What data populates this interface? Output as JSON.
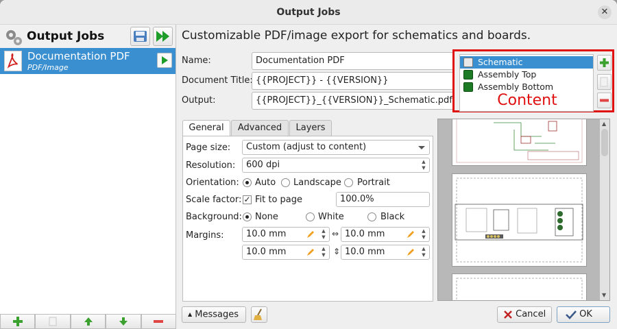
{
  "window": {
    "title": "Output Jobs"
  },
  "left_panel": {
    "title": "Output Jobs",
    "jobs": [
      {
        "name": "Documentation PDF",
        "type": "PDF/Image"
      }
    ]
  },
  "main": {
    "heading": "Customizable PDF/image export for schematics and boards.",
    "fields": {
      "name_label": "Name:",
      "name_value": "Documentation PDF",
      "doc_title_label": "Document Title:",
      "doc_title_value": "{{PROJECT}} - {{VERSION}}",
      "output_label": "Output:",
      "output_value": "{{PROJECT}}_{{VERSION}}_Schematic.pdf"
    },
    "content": {
      "items": [
        "Schematic",
        "Assembly Top",
        "Assembly Bottom"
      ],
      "selected": "Schematic",
      "caption": "Content"
    },
    "tabs": [
      "General",
      "Advanced",
      "Layers"
    ],
    "general": {
      "page_size_label": "Page size:",
      "page_size_value": "Custom (adjust to content)",
      "resolution_label": "Resolution:",
      "resolution_value": "600 dpi",
      "orientation_label": "Orientation:",
      "orientation_options": [
        "Auto",
        "Landscape",
        "Portrait"
      ],
      "orientation_selected": "Auto",
      "scale_label": "Scale factor:",
      "fit_to_page_label": "Fit to page",
      "fit_to_page_checked": true,
      "scale_value": "100.0%",
      "background_label": "Background:",
      "background_options": [
        "None",
        "White",
        "Black"
      ],
      "background_selected": "None",
      "margins_label": "Margins:",
      "margins": [
        "10.0 mm",
        "10.0 mm",
        "10.0 mm",
        "10.0 mm"
      ]
    }
  },
  "buttons": {
    "messages": "Messages",
    "cancel": "Cancel",
    "ok": "OK"
  },
  "colors": {
    "selection": "#3a8fd0",
    "highlight_box": "#e01010",
    "add_green": "#3aa02e",
    "remove_red": "#e04545"
  }
}
